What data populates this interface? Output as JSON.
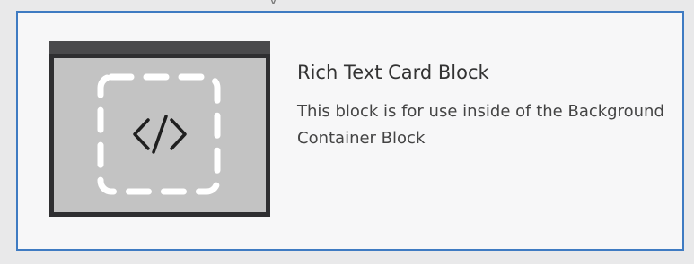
{
  "top_text_fragment": "y",
  "card": {
    "title": "Rich Text Card Block",
    "description": "This block is for use inside of the Background Container Block",
    "thumbnail_icon": "code-icon"
  },
  "colors": {
    "page_background": "#e9e9ea",
    "card_background": "#f7f7f8",
    "card_border": "#3f7bc2",
    "thumbnail_frame": "#2f2f31",
    "thumbnail_fill": "#c3c3c3"
  }
}
